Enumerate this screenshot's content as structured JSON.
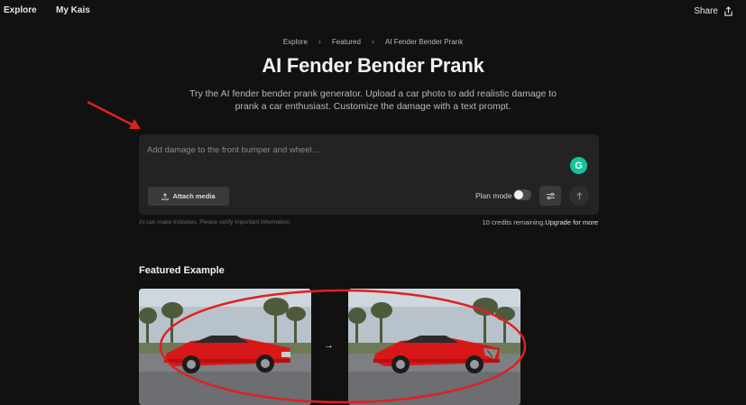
{
  "nav": {
    "explore": "Explore",
    "mykais": "My Kais",
    "share": "Share"
  },
  "breadcrumb": [
    "Explore",
    "Featured",
    "AI Fender Bender Prank"
  ],
  "page": {
    "title": "AI Fender Bender Prank",
    "subtitle": "Try the AI fender bender prank generator. Upload a car photo to add realistic damage to prank a car enthusiast. Customize the damage with a text prompt."
  },
  "prompt": {
    "placeholder": "Add damage to the front bumper and wheel...",
    "attach_label": "Attach media",
    "plan_mode_label": "Plan mode",
    "plan_mode_on": false,
    "grammarly_glyph": "G"
  },
  "footer": {
    "disclaimer": "AI can make mistakes. Please verify important information.",
    "credits": "10 credits remaining.",
    "upgrade": "Upgrade for more"
  },
  "featured": {
    "title": "Featured Example",
    "arrow": "→"
  },
  "icons": {
    "share": "share-icon",
    "upload": "upload-icon",
    "settings": "sliders-icon",
    "send": "arrow-up-icon",
    "grammarly": "grammarly-icon"
  },
  "colors": {
    "background": "#111111",
    "panel": "#232323",
    "button": "#3a3a3a",
    "annotation": "#e02020",
    "car": "#d81818",
    "grammarly": "#15c39a"
  }
}
